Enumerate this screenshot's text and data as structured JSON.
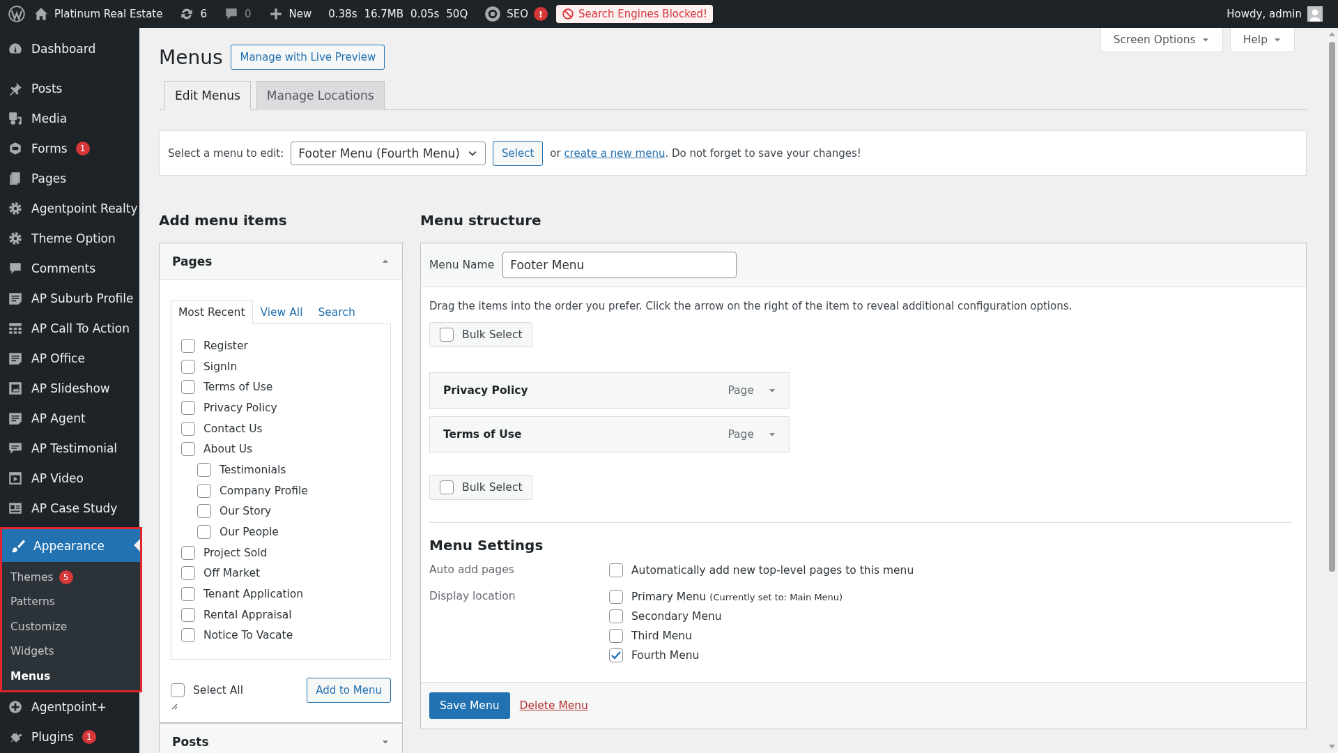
{
  "admin_bar": {
    "site_name": "Platinum Real Estate",
    "updates": "6",
    "comments": "0",
    "new": "New",
    "stats": [
      "0.38s",
      "16.7MB",
      "0.05s",
      "50Q"
    ],
    "seo": "SEO",
    "seo_alert": "!",
    "blocked": "Search Engines Blocked!",
    "greeting": "Howdy, admin"
  },
  "sidebar": {
    "items": [
      {
        "label": "Dashboard",
        "selected": false
      },
      {
        "label": "Posts",
        "selected": false
      },
      {
        "label": "Media",
        "selected": false
      },
      {
        "label": "Forms",
        "badge": "1",
        "selected": false
      },
      {
        "label": "Pages",
        "selected": false
      },
      {
        "label": "Agentpoint Realty",
        "selected": false
      },
      {
        "label": "Theme Option",
        "selected": false
      },
      {
        "label": "Comments",
        "selected": false
      },
      {
        "label": "AP Suburb Profile",
        "selected": false
      },
      {
        "label": "AP Call To Action",
        "selected": false
      },
      {
        "label": "AP Office",
        "selected": false
      },
      {
        "label": "AP Slideshow",
        "selected": false
      },
      {
        "label": "AP Agent",
        "selected": false
      },
      {
        "label": "AP Testimonial",
        "selected": false
      },
      {
        "label": "AP Video",
        "selected": false
      },
      {
        "label": "AP Case Study",
        "selected": false
      },
      {
        "label": "Appearance",
        "selected": true,
        "children": [
          {
            "label": "Themes",
            "badge": "5",
            "selected": false
          },
          {
            "label": "Patterns",
            "selected": false
          },
          {
            "label": "Customize",
            "selected": false
          },
          {
            "label": "Widgets",
            "selected": false
          },
          {
            "label": "Menus",
            "selected": true
          }
        ]
      },
      {
        "label": "Agentpoint+",
        "selected": false
      },
      {
        "label": "Plugins",
        "badge": "1",
        "selected": false
      }
    ]
  },
  "screen_options": "Screen Options",
  "help": "Help",
  "page_title": "Menus",
  "live_preview": "Manage with Live Preview",
  "tabs": [
    {
      "label": "Edit Menus",
      "selected": true
    },
    {
      "label": "Manage Locations",
      "selected": false
    }
  ],
  "menu_select": {
    "label": "Select a menu to edit:",
    "value": "Footer Menu (Fourth Menu)",
    "button": "Select",
    "prefix": "or ",
    "link": "create a new menu",
    "suffix": ". Do not forget to save your changes!"
  },
  "add_menu_items": {
    "title": "Add menu items",
    "panels": [
      {
        "title": "Pages",
        "expanded": true,
        "tabs": [
          {
            "label": "Most Recent",
            "selected": true
          },
          {
            "label": "View All",
            "selected": false
          },
          {
            "label": "Search",
            "selected": false
          }
        ],
        "items": [
          {
            "label": "Register",
            "checked": false
          },
          {
            "label": "SignIn",
            "checked": false
          },
          {
            "label": "Terms of Use",
            "checked": false
          },
          {
            "label": "Privacy Policy",
            "checked": false
          },
          {
            "label": "Contact Us",
            "checked": false
          },
          {
            "label": "About Us",
            "checked": false,
            "children": [
              {
                "label": "Testimonials",
                "checked": false
              },
              {
                "label": "Company Profile",
                "checked": false
              },
              {
                "label": "Our Story",
                "checked": false
              },
              {
                "label": "Our People",
                "checked": false
              }
            ]
          },
          {
            "label": "Project Sold",
            "checked": false
          },
          {
            "label": "Off Market",
            "checked": false
          },
          {
            "label": "Tenant Application",
            "checked": false
          },
          {
            "label": "Rental Appraisal",
            "checked": false
          },
          {
            "label": "Notice To Vacate",
            "checked": false
          }
        ],
        "select_all": {
          "label": "Select All",
          "checked": false
        },
        "button": "Add to Menu"
      },
      {
        "title": "Posts",
        "expanded": false
      }
    ]
  },
  "menu_structure": {
    "title": "Menu structure",
    "name_label": "Menu Name",
    "name_value": "Footer Menu",
    "instructions": "Drag the items into the order you prefer. Click the arrow on the right of the item to reveal additional configuration options.",
    "bulk_select_top": {
      "label": "Bulk Select",
      "checked": false
    },
    "items": [
      {
        "title": "Privacy Policy",
        "type": "Page"
      },
      {
        "title": "Terms of Use",
        "type": "Page"
      }
    ],
    "bulk_select_bottom": {
      "label": "Bulk Select",
      "checked": false
    },
    "settings": {
      "title": "Menu Settings",
      "groups": [
        {
          "label": "Auto add pages",
          "options": [
            {
              "label": "Automatically add new top-level pages to this menu",
              "checked": false
            }
          ]
        },
        {
          "label": "Display location",
          "options": [
            {
              "label": "Primary Menu",
              "note": "(Currently set to: Main Menu)",
              "checked": false
            },
            {
              "label": "Secondary Menu",
              "checked": false
            },
            {
              "label": "Third Menu",
              "checked": false
            },
            {
              "label": "Fourth Menu",
              "checked": true
            }
          ]
        }
      ]
    },
    "save_button": "Save Menu",
    "delete_link": "Delete Menu"
  }
}
